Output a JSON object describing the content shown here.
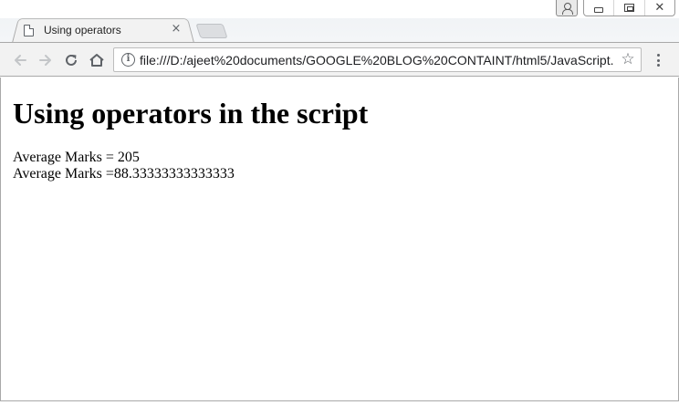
{
  "browser": {
    "tab": {
      "title": "Using operators",
      "close_glyph": "×",
      "page_icon": "document-icon"
    },
    "new_tab_icon": "new-tab-icon",
    "window_controls": {
      "user": "user-icon",
      "minimize": "minimize-icon",
      "maximize": "restore-icon",
      "close": "close-icon"
    },
    "toolbar": {
      "back": "back-arrow-icon",
      "forward": "forward-arrow-icon",
      "reload": "reload-icon",
      "home": "home-icon",
      "url": "file:///D:/ajeet%20documents/GOOGLE%20BLOG%20CONTAINT/html5/JavaScript...",
      "info_glyph": "i",
      "star_glyph": "☆",
      "menu": "more-vert-icon"
    }
  },
  "page": {
    "heading": "Using operators in the script",
    "lines": [
      "Average Marks = 205",
      "Average Marks =88.33333333333333"
    ]
  }
}
